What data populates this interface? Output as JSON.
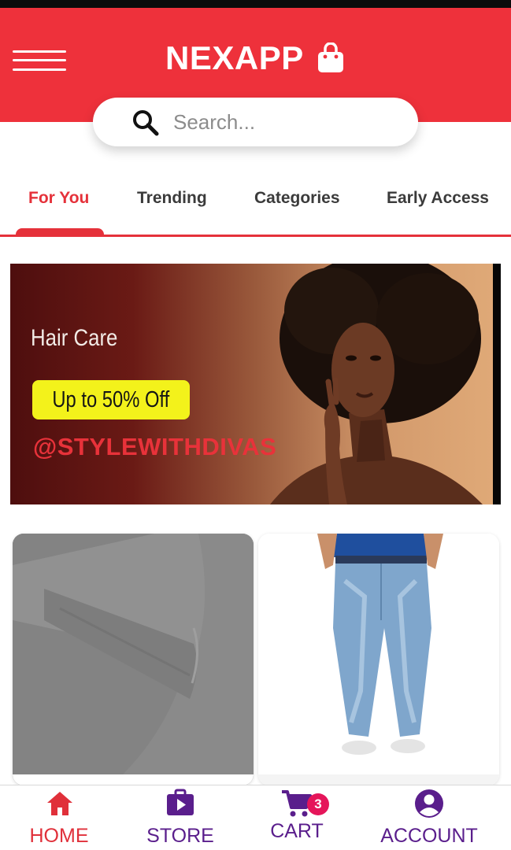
{
  "app": {
    "title": "NEXAPP",
    "brand_color": "#ee313b",
    "icons": {
      "menu": "hamburger-menu-icon",
      "brand": "shopping-bag-icon"
    }
  },
  "search": {
    "placeholder": "Search...",
    "value": "",
    "icon": "search-icon"
  },
  "tabs": [
    {
      "label": "For You",
      "active": true
    },
    {
      "label": "Trending",
      "active": false
    },
    {
      "label": "Categories",
      "active": false
    },
    {
      "label": "Early Access",
      "active": false
    }
  ],
  "banner": {
    "category": "Hair Care",
    "offer": "Up to 50% Off",
    "handle": "@STYLEWITHDIVAS",
    "offer_color": "#f3f21b",
    "handle_color": "#e8323a"
  },
  "products": [
    {
      "image": "grey-bedsheet-photo"
    },
    {
      "image": "blue-jeans-photo"
    }
  ],
  "bottom_nav": {
    "items": [
      {
        "label": "HOME",
        "icon": "home-icon",
        "active": true
      },
      {
        "label": "STORE",
        "icon": "store-bag-icon",
        "active": false
      },
      {
        "label": "CART",
        "icon": "cart-icon",
        "active": false,
        "badge": "3"
      },
      {
        "label": "ACCOUNT",
        "icon": "account-icon",
        "active": false
      }
    ],
    "active_color": "#e0303a",
    "inactive_color": "#5a1e8c"
  }
}
